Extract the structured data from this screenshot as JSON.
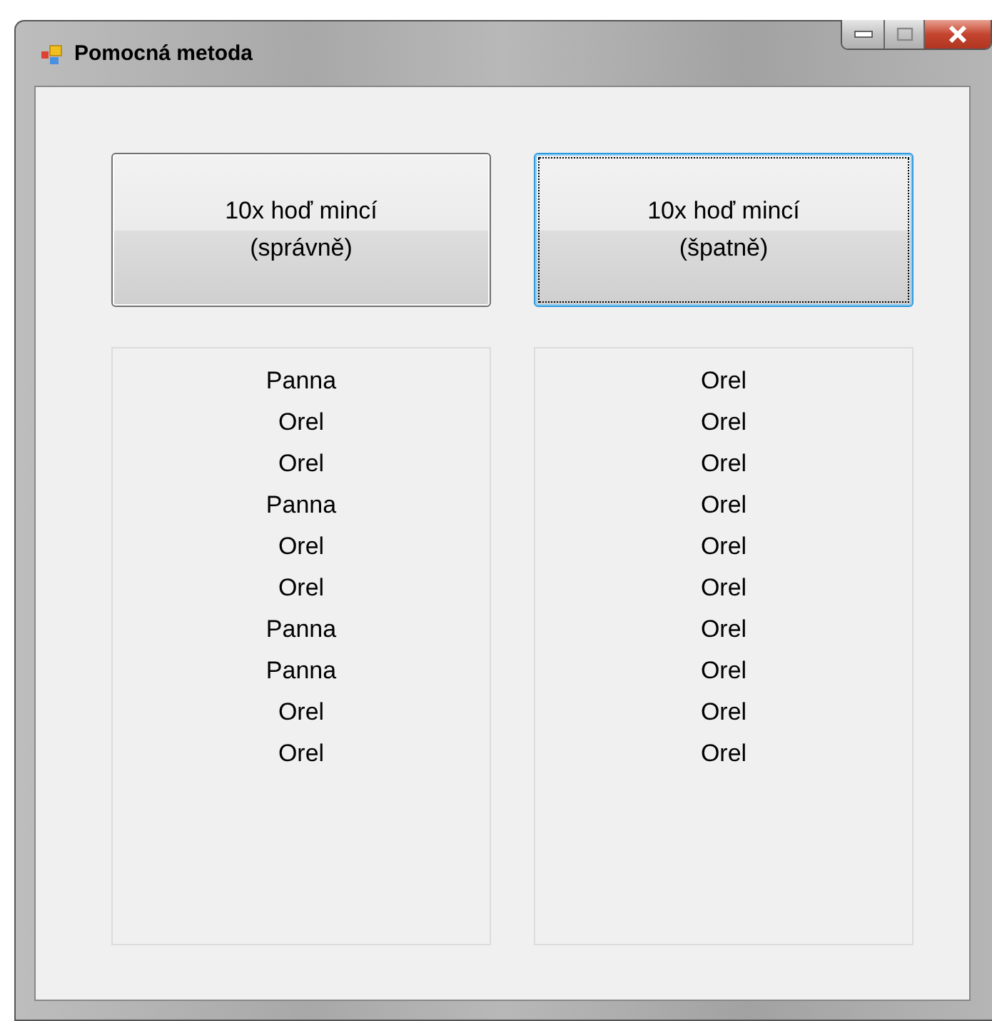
{
  "window": {
    "title": "Pomocná metoda"
  },
  "buttons": [
    {
      "label": "10x hoď mincí\n(správně)",
      "focused": false
    },
    {
      "label": "10x hoď mincí\n(špatně)",
      "focused": true
    }
  ],
  "lists": [
    {
      "items": [
        "Panna",
        "Orel",
        "Orel",
        "Panna",
        "Orel",
        "Orel",
        "Panna",
        "Panna",
        "Orel",
        "Orel"
      ]
    },
    {
      "items": [
        "Orel",
        "Orel",
        "Orel",
        "Orel",
        "Orel",
        "Orel",
        "Orel",
        "Orel",
        "Orel",
        "Orel"
      ]
    }
  ]
}
